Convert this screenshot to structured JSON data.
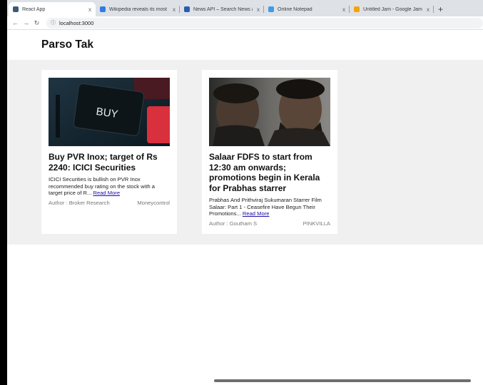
{
  "browser": {
    "tabs": [
      {
        "title": "React App",
        "active": true,
        "favicon_color": "#3a5a78",
        "icon": "react-favicon"
      },
      {
        "title": "Wikipedia reveals its most vie",
        "active": false,
        "favicon_color": "#2f7de1",
        "icon": "web-favicon"
      },
      {
        "title": "News API – Search News and",
        "active": false,
        "favicon_color": "#2a5db0",
        "icon": "document-favicon"
      },
      {
        "title": "Online Notepad",
        "active": false,
        "favicon_color": "#3d9be9",
        "icon": "notepad-favicon"
      },
      {
        "title": "Untitled Jam - Google Jambo",
        "active": false,
        "favicon_color": "#f4a300",
        "icon": "jamboard-favicon"
      }
    ],
    "close_glyph": "x",
    "newtab_glyph": "+",
    "url": "localhost:3000"
  },
  "site": {
    "brand": "Parso Tak"
  },
  "articles": [
    {
      "title": "Buy PVR Inox; target of Rs 2240: ICICI Securities",
      "description": "ICICI Securities is bullish on PVR Inox recommended buy rating on the stock with a target price of R...",
      "read_more": "Read More",
      "author": "Author : Broker Research",
      "source": "Moneycontrol",
      "image_text": "BUY"
    },
    {
      "title": "Salaar FDFS to start from 12:30 am onwards; promotions begin in Kerala for Prabhas starrer",
      "description": "Prabhas And Prithviraj Sukumaran Starrer Film Salaar: Part 1 - Ceasefire Have Begun Their Promotions...",
      "read_more": "Read More",
      "author": "Author : Goutham S",
      "source": "PINKVILLA"
    }
  ],
  "colors": {
    "link": "#1a0dab",
    "content_bg": "#f0f0f0"
  }
}
